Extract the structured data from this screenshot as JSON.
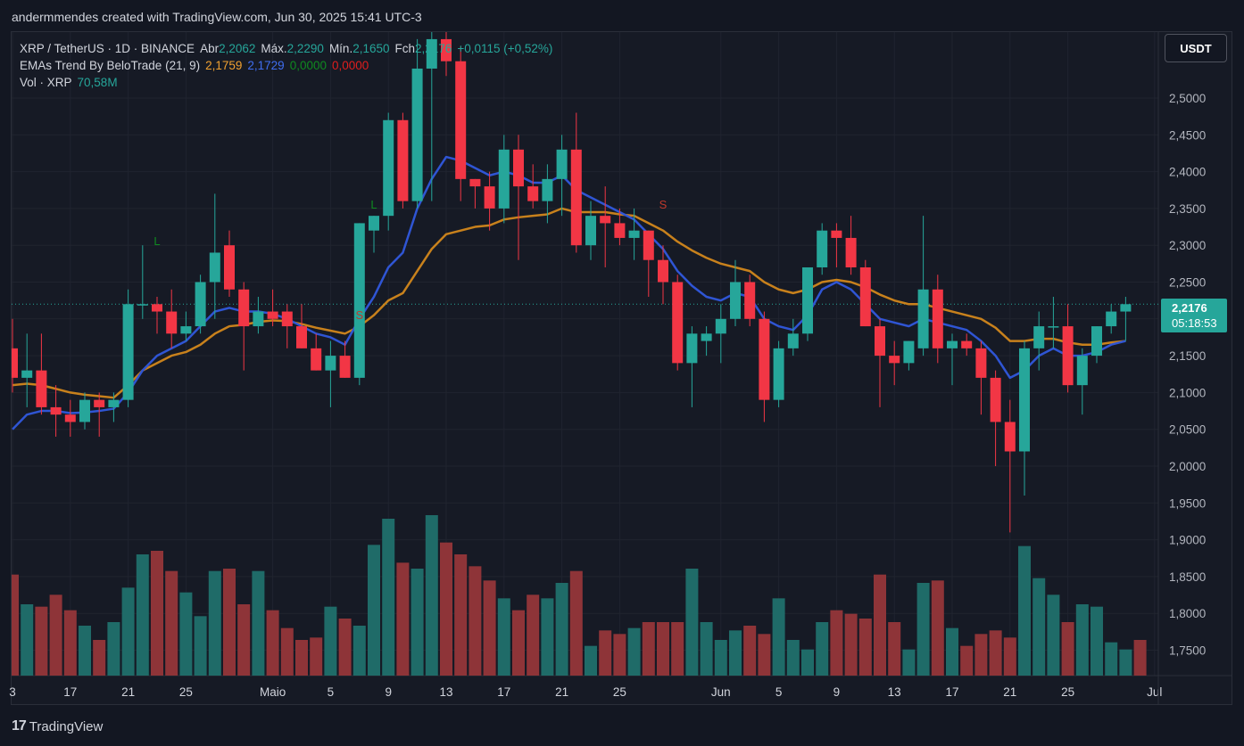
{
  "header": {
    "credit": "andermmendes created with TradingView.com, Jun 30, 2025 15:41 UTC-3"
  },
  "legend": {
    "symbol": "XRP / TetherUS · 1D · BINANCE",
    "open_label": "Abr",
    "open_value": "2,2062",
    "high_label": "Máx.",
    "high_value": "2,2290",
    "low_label": "Mín.",
    "low_value": "2,1650",
    "close_label": "Fch",
    "close_value": "2,2176",
    "change_value": "+0,0115 (+0,52%)",
    "ema_name": "EMAs Trend By BeloTrade (21, 9)",
    "ema_v1": "2,1759",
    "ema_v2": "2,1729",
    "ema_v3": "0,0000",
    "ema_v4": "0,0000",
    "vol_label": "Vol · XRP",
    "vol_value": "70,58M"
  },
  "currency_button": "USDT",
  "price_tag": {
    "price": "2,2176",
    "countdown": "05:18:53"
  },
  "footer": {
    "brand": "TradingView",
    "logo_glyph": "17"
  },
  "colors": {
    "up": "#26a69a",
    "down": "#f23645",
    "ema_fast": "#2f55d4",
    "ema_slow": "#c8811c",
    "vol_up": "#1f6b68",
    "vol_down": "#8e3438",
    "signal_long": "#0f8a20",
    "signal_short": "#c0392b"
  },
  "chart_data": {
    "type": "candlestick",
    "y_axis_labels": [
      "2,5000",
      "2,4500",
      "2,4000",
      "2,3500",
      "2,3000",
      "2,2500",
      "2,2000",
      "2,1500",
      "2,1000",
      "2,0500",
      "2,0000",
      "1,9500",
      "1,9000",
      "1,8500",
      "1,8000",
      "1,7500"
    ],
    "ylim": [
      1.715,
      2.573
    ],
    "x_axis_labels": [
      {
        "label": "3",
        "day": 0
      },
      {
        "label": "17",
        "day": 4
      },
      {
        "label": "21",
        "day": 8
      },
      {
        "label": "25",
        "day": 12
      },
      {
        "label": "Maio",
        "day": 18
      },
      {
        "label": "5",
        "day": 22
      },
      {
        "label": "9",
        "day": 26
      },
      {
        "label": "13",
        "day": 30
      },
      {
        "label": "17",
        "day": 34
      },
      {
        "label": "21",
        "day": 38
      },
      {
        "label": "25",
        "day": 42
      },
      {
        "label": "Jun",
        "day": 49
      },
      {
        "label": "5",
        "day": 53
      },
      {
        "label": "9",
        "day": 57
      },
      {
        "label": "13",
        "day": 61
      },
      {
        "label": "17",
        "day": 65
      },
      {
        "label": "21",
        "day": 69
      },
      {
        "label": "25",
        "day": 73
      },
      {
        "label": "Jul",
        "day": 79
      }
    ],
    "candles": [
      {
        "o": 2.16,
        "h": 2.2,
        "l": 2.1,
        "c": 2.12
      },
      {
        "o": 2.12,
        "h": 2.18,
        "l": 2.08,
        "c": 2.13
      },
      {
        "o": 2.13,
        "h": 2.18,
        "l": 2.07,
        "c": 2.08
      },
      {
        "o": 2.08,
        "h": 2.11,
        "l": 2.04,
        "c": 2.07
      },
      {
        "o": 2.07,
        "h": 2.09,
        "l": 2.04,
        "c": 2.06
      },
      {
        "o": 2.06,
        "h": 2.1,
        "l": 2.05,
        "c": 2.09
      },
      {
        "o": 2.09,
        "h": 2.1,
        "l": 2.04,
        "c": 2.08
      },
      {
        "o": 2.08,
        "h": 2.1,
        "l": 2.06,
        "c": 2.09
      },
      {
        "o": 2.09,
        "h": 2.24,
        "l": 2.08,
        "c": 2.22
      },
      {
        "o": 2.22,
        "h": 2.3,
        "l": 2.2,
        "c": 2.22
      },
      {
        "o": 2.22,
        "h": 2.23,
        "l": 2.18,
        "c": 2.21
      },
      {
        "o": 2.21,
        "h": 2.24,
        "l": 2.16,
        "c": 2.18
      },
      {
        "o": 2.18,
        "h": 2.21,
        "l": 2.17,
        "c": 2.19
      },
      {
        "o": 2.19,
        "h": 2.26,
        "l": 2.18,
        "c": 2.25
      },
      {
        "o": 2.25,
        "h": 2.37,
        "l": 2.2,
        "c": 2.29
      },
      {
        "o": 2.3,
        "h": 2.32,
        "l": 2.23,
        "c": 2.24
      },
      {
        "o": 2.24,
        "h": 2.25,
        "l": 2.13,
        "c": 2.19
      },
      {
        "o": 2.19,
        "h": 2.23,
        "l": 2.18,
        "c": 2.21
      },
      {
        "o": 2.21,
        "h": 2.24,
        "l": 2.19,
        "c": 2.2
      },
      {
        "o": 2.21,
        "h": 2.22,
        "l": 2.16,
        "c": 2.19
      },
      {
        "o": 2.19,
        "h": 2.22,
        "l": 2.16,
        "c": 2.16
      },
      {
        "o": 2.16,
        "h": 2.18,
        "l": 2.13,
        "c": 2.13
      },
      {
        "o": 2.13,
        "h": 2.17,
        "l": 2.08,
        "c": 2.15
      },
      {
        "o": 2.15,
        "h": 2.17,
        "l": 2.12,
        "c": 2.12
      },
      {
        "o": 2.12,
        "h": 2.33,
        "l": 2.11,
        "c": 2.33
      },
      {
        "o": 2.32,
        "h": 2.34,
        "l": 2.29,
        "c": 2.34
      },
      {
        "o": 2.34,
        "h": 2.48,
        "l": 2.32,
        "c": 2.47
      },
      {
        "o": 2.47,
        "h": 2.48,
        "l": 2.35,
        "c": 2.36
      },
      {
        "o": 2.36,
        "h": 2.58,
        "l": 2.35,
        "c": 2.54
      },
      {
        "o": 2.54,
        "h": 2.62,
        "l": 2.36,
        "c": 2.58
      },
      {
        "o": 2.58,
        "h": 2.66,
        "l": 2.53,
        "c": 2.55
      },
      {
        "o": 2.55,
        "h": 2.57,
        "l": 2.36,
        "c": 2.39
      },
      {
        "o": 2.39,
        "h": 2.39,
        "l": 2.35,
        "c": 2.38
      },
      {
        "o": 2.38,
        "h": 2.4,
        "l": 2.32,
        "c": 2.35
      },
      {
        "o": 2.35,
        "h": 2.45,
        "l": 2.33,
        "c": 2.43
      },
      {
        "o": 2.43,
        "h": 2.45,
        "l": 2.28,
        "c": 2.38
      },
      {
        "o": 2.38,
        "h": 2.41,
        "l": 2.35,
        "c": 2.36
      },
      {
        "o": 2.36,
        "h": 2.41,
        "l": 2.33,
        "c": 2.39
      },
      {
        "o": 2.39,
        "h": 2.45,
        "l": 2.34,
        "c": 2.43
      },
      {
        "o": 2.43,
        "h": 2.48,
        "l": 2.29,
        "c": 2.3
      },
      {
        "o": 2.3,
        "h": 2.36,
        "l": 2.28,
        "c": 2.34
      },
      {
        "o": 2.34,
        "h": 2.38,
        "l": 2.27,
        "c": 2.33
      },
      {
        "o": 2.33,
        "h": 2.35,
        "l": 2.3,
        "c": 2.31
      },
      {
        "o": 2.31,
        "h": 2.35,
        "l": 2.28,
        "c": 2.32
      },
      {
        "o": 2.32,
        "h": 2.32,
        "l": 2.23,
        "c": 2.28
      },
      {
        "o": 2.28,
        "h": 2.3,
        "l": 2.22,
        "c": 2.25
      },
      {
        "o": 2.25,
        "h": 2.26,
        "l": 2.13,
        "c": 2.14
      },
      {
        "o": 2.14,
        "h": 2.19,
        "l": 2.08,
        "c": 2.18
      },
      {
        "o": 2.17,
        "h": 2.19,
        "l": 2.15,
        "c": 2.18
      },
      {
        "o": 2.18,
        "h": 2.22,
        "l": 2.14,
        "c": 2.2
      },
      {
        "o": 2.2,
        "h": 2.28,
        "l": 2.19,
        "c": 2.25
      },
      {
        "o": 2.25,
        "h": 2.26,
        "l": 2.19,
        "c": 2.2
      },
      {
        "o": 2.2,
        "h": 2.21,
        "l": 2.06,
        "c": 2.09
      },
      {
        "o": 2.09,
        "h": 2.17,
        "l": 2.08,
        "c": 2.16
      },
      {
        "o": 2.16,
        "h": 2.2,
        "l": 2.15,
        "c": 2.18
      },
      {
        "o": 2.18,
        "h": 2.27,
        "l": 2.17,
        "c": 2.27
      },
      {
        "o": 2.27,
        "h": 2.33,
        "l": 2.26,
        "c": 2.32
      },
      {
        "o": 2.32,
        "h": 2.33,
        "l": 2.27,
        "c": 2.31
      },
      {
        "o": 2.31,
        "h": 2.34,
        "l": 2.26,
        "c": 2.27
      },
      {
        "o": 2.27,
        "h": 2.28,
        "l": 2.19,
        "c": 2.19
      },
      {
        "o": 2.19,
        "h": 2.2,
        "l": 2.08,
        "c": 2.15
      },
      {
        "o": 2.15,
        "h": 2.17,
        "l": 2.11,
        "c": 2.14
      },
      {
        "o": 2.14,
        "h": 2.17,
        "l": 2.13,
        "c": 2.17
      },
      {
        "o": 2.16,
        "h": 2.34,
        "l": 2.15,
        "c": 2.24
      },
      {
        "o": 2.24,
        "h": 2.26,
        "l": 2.14,
        "c": 2.16
      },
      {
        "o": 2.16,
        "h": 2.18,
        "l": 2.11,
        "c": 2.17
      },
      {
        "o": 2.17,
        "h": 2.18,
        "l": 2.15,
        "c": 2.16
      },
      {
        "o": 2.16,
        "h": 2.17,
        "l": 2.07,
        "c": 2.12
      },
      {
        "o": 2.12,
        "h": 2.13,
        "l": 2.0,
        "c": 2.06
      },
      {
        "o": 2.06,
        "h": 2.09,
        "l": 1.91,
        "c": 2.02
      },
      {
        "o": 2.02,
        "h": 2.17,
        "l": 1.96,
        "c": 2.16
      },
      {
        "o": 2.16,
        "h": 2.21,
        "l": 2.13,
        "c": 2.19
      },
      {
        "o": 2.19,
        "h": 2.23,
        "l": 2.16,
        "c": 2.19
      },
      {
        "o": 2.19,
        "h": 2.22,
        "l": 2.1,
        "c": 2.11
      },
      {
        "o": 2.11,
        "h": 2.16,
        "l": 2.07,
        "c": 2.15
      },
      {
        "o": 2.15,
        "h": 2.19,
        "l": 2.14,
        "c": 2.19
      },
      {
        "o": 2.19,
        "h": 2.22,
        "l": 2.18,
        "c": 2.21
      },
      {
        "o": 2.21,
        "h": 2.23,
        "l": 2.17,
        "c": 2.22
      }
    ],
    "volumes": [
      85,
      60,
      58,
      68,
      55,
      42,
      30,
      45,
      74,
      102,
      105,
      88,
      70,
      50,
      88,
      90,
      60,
      88,
      55,
      40,
      30,
      32,
      58,
      48,
      42,
      110,
      132,
      95,
      90,
      135,
      112,
      102,
      92,
      80,
      65,
      55,
      68,
      65,
      78,
      88,
      25,
      38,
      35,
      40,
      45,
      45,
      45,
      90,
      45,
      30,
      38,
      42,
      35,
      65,
      30,
      22,
      45,
      55,
      52,
      48,
      85,
      45,
      22,
      78,
      80,
      40,
      25,
      35,
      38,
      32,
      109,
      82,
      68,
      45,
      60,
      58,
      28,
      22,
      30
    ],
    "vol_scale_note": "relative bar heights, scaled to panel",
    "ema_fast": [
      2.05,
      2.07,
      2.075,
      2.075,
      2.072,
      2.073,
      2.075,
      2.078,
      2.1,
      2.13,
      2.15,
      2.16,
      2.17,
      2.19,
      2.21,
      2.215,
      2.21,
      2.21,
      2.207,
      2.2,
      2.19,
      2.18,
      2.175,
      2.165,
      2.2,
      2.23,
      2.27,
      2.29,
      2.35,
      2.39,
      2.42,
      2.415,
      2.405,
      2.395,
      2.4,
      2.395,
      2.385,
      2.385,
      2.395,
      2.375,
      2.365,
      2.355,
      2.345,
      2.335,
      2.315,
      2.295,
      2.265,
      2.245,
      2.23,
      2.225,
      2.235,
      2.23,
      2.2,
      2.19,
      2.185,
      2.205,
      2.24,
      2.25,
      2.24,
      2.22,
      2.2,
      2.195,
      2.19,
      2.2,
      2.195,
      2.19,
      2.185,
      2.17,
      2.15,
      2.12,
      2.13,
      2.15,
      2.16,
      2.15,
      2.15,
      2.155,
      2.165,
      2.17
    ],
    "ema_slow": [
      2.11,
      2.112,
      2.11,
      2.105,
      2.1,
      2.097,
      2.095,
      2.093,
      2.11,
      2.13,
      2.14,
      2.15,
      2.155,
      2.165,
      2.18,
      2.19,
      2.192,
      2.196,
      2.198,
      2.197,
      2.193,
      2.188,
      2.184,
      2.18,
      2.19,
      2.205,
      2.225,
      2.235,
      2.265,
      2.295,
      2.315,
      2.32,
      2.325,
      2.327,
      2.335,
      2.338,
      2.34,
      2.342,
      2.35,
      2.345,
      2.345,
      2.345,
      2.342,
      2.34,
      2.33,
      2.32,
      2.305,
      2.293,
      2.283,
      2.275,
      2.27,
      2.265,
      2.25,
      2.24,
      2.235,
      2.24,
      2.25,
      2.253,
      2.25,
      2.243,
      2.233,
      2.225,
      2.22,
      2.22,
      2.215,
      2.21,
      2.205,
      2.2,
      2.188,
      2.17,
      2.17,
      2.173,
      2.173,
      2.168,
      2.165,
      2.165,
      2.168,
      2.17
    ],
    "signals": [
      {
        "label": "L",
        "day": 10,
        "price": 2.3
      },
      {
        "label": "S",
        "day": 24,
        "price": 2.2
      },
      {
        "label": "L",
        "day": 25,
        "price": 2.35
      },
      {
        "label": "S",
        "day": 45,
        "price": 2.35
      }
    ]
  }
}
